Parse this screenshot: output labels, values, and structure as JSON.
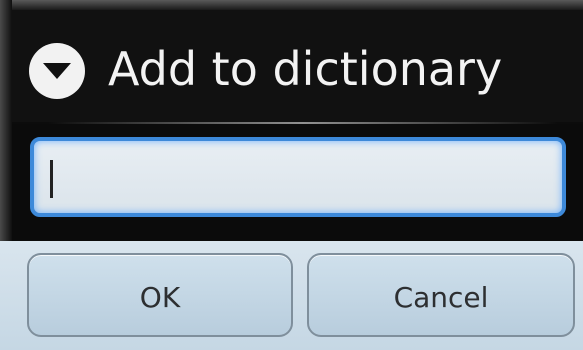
{
  "dialog": {
    "title": "Add to dictionary",
    "input": {
      "value": "",
      "placeholder": ""
    },
    "buttons": {
      "ok_label": "OK",
      "cancel_label": "Cancel"
    },
    "icons": {
      "title_icon": "chevron-down-circle-icon"
    },
    "colors": {
      "accent": "#3d89d9",
      "title_text": "#f3f3f3",
      "button_background": "#c5d7e4"
    }
  }
}
